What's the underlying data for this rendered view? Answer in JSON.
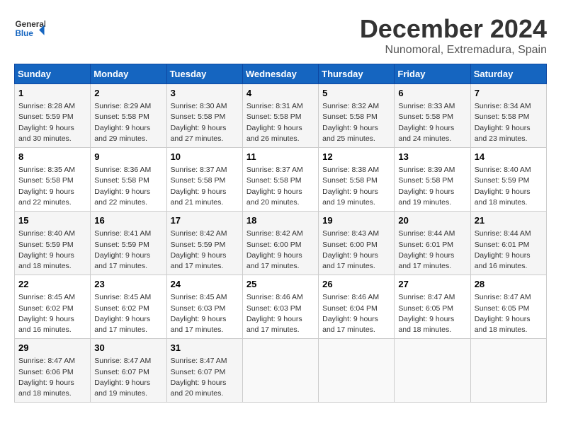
{
  "header": {
    "logo_general": "General",
    "logo_blue": "Blue",
    "month": "December 2024",
    "location": "Nunomoral, Extremadura, Spain"
  },
  "weekdays": [
    "Sunday",
    "Monday",
    "Tuesday",
    "Wednesday",
    "Thursday",
    "Friday",
    "Saturday"
  ],
  "weeks": [
    [
      {
        "day": "1",
        "sunrise": "Sunrise: 8:28 AM",
        "sunset": "Sunset: 5:59 PM",
        "daylight": "Daylight: 9 hours and 30 minutes."
      },
      {
        "day": "2",
        "sunrise": "Sunrise: 8:29 AM",
        "sunset": "Sunset: 5:58 PM",
        "daylight": "Daylight: 9 hours and 29 minutes."
      },
      {
        "day": "3",
        "sunrise": "Sunrise: 8:30 AM",
        "sunset": "Sunset: 5:58 PM",
        "daylight": "Daylight: 9 hours and 27 minutes."
      },
      {
        "day": "4",
        "sunrise": "Sunrise: 8:31 AM",
        "sunset": "Sunset: 5:58 PM",
        "daylight": "Daylight: 9 hours and 26 minutes."
      },
      {
        "day": "5",
        "sunrise": "Sunrise: 8:32 AM",
        "sunset": "Sunset: 5:58 PM",
        "daylight": "Daylight: 9 hours and 25 minutes."
      },
      {
        "day": "6",
        "sunrise": "Sunrise: 8:33 AM",
        "sunset": "Sunset: 5:58 PM",
        "daylight": "Daylight: 9 hours and 24 minutes."
      },
      {
        "day": "7",
        "sunrise": "Sunrise: 8:34 AM",
        "sunset": "Sunset: 5:58 PM",
        "daylight": "Daylight: 9 hours and 23 minutes."
      }
    ],
    [
      {
        "day": "8",
        "sunrise": "Sunrise: 8:35 AM",
        "sunset": "Sunset: 5:58 PM",
        "daylight": "Daylight: 9 hours and 22 minutes."
      },
      {
        "day": "9",
        "sunrise": "Sunrise: 8:36 AM",
        "sunset": "Sunset: 5:58 PM",
        "daylight": "Daylight: 9 hours and 22 minutes."
      },
      {
        "day": "10",
        "sunrise": "Sunrise: 8:37 AM",
        "sunset": "Sunset: 5:58 PM",
        "daylight": "Daylight: 9 hours and 21 minutes."
      },
      {
        "day": "11",
        "sunrise": "Sunrise: 8:37 AM",
        "sunset": "Sunset: 5:58 PM",
        "daylight": "Daylight: 9 hours and 20 minutes."
      },
      {
        "day": "12",
        "sunrise": "Sunrise: 8:38 AM",
        "sunset": "Sunset: 5:58 PM",
        "daylight": "Daylight: 9 hours and 19 minutes."
      },
      {
        "day": "13",
        "sunrise": "Sunrise: 8:39 AM",
        "sunset": "Sunset: 5:58 PM",
        "daylight": "Daylight: 9 hours and 19 minutes."
      },
      {
        "day": "14",
        "sunrise": "Sunrise: 8:40 AM",
        "sunset": "Sunset: 5:59 PM",
        "daylight": "Daylight: 9 hours and 18 minutes."
      }
    ],
    [
      {
        "day": "15",
        "sunrise": "Sunrise: 8:40 AM",
        "sunset": "Sunset: 5:59 PM",
        "daylight": "Daylight: 9 hours and 18 minutes."
      },
      {
        "day": "16",
        "sunrise": "Sunrise: 8:41 AM",
        "sunset": "Sunset: 5:59 PM",
        "daylight": "Daylight: 9 hours and 17 minutes."
      },
      {
        "day": "17",
        "sunrise": "Sunrise: 8:42 AM",
        "sunset": "Sunset: 5:59 PM",
        "daylight": "Daylight: 9 hours and 17 minutes."
      },
      {
        "day": "18",
        "sunrise": "Sunrise: 8:42 AM",
        "sunset": "Sunset: 6:00 PM",
        "daylight": "Daylight: 9 hours and 17 minutes."
      },
      {
        "day": "19",
        "sunrise": "Sunrise: 8:43 AM",
        "sunset": "Sunset: 6:00 PM",
        "daylight": "Daylight: 9 hours and 17 minutes."
      },
      {
        "day": "20",
        "sunrise": "Sunrise: 8:44 AM",
        "sunset": "Sunset: 6:01 PM",
        "daylight": "Daylight: 9 hours and 17 minutes."
      },
      {
        "day": "21",
        "sunrise": "Sunrise: 8:44 AM",
        "sunset": "Sunset: 6:01 PM",
        "daylight": "Daylight: 9 hours and 16 minutes."
      }
    ],
    [
      {
        "day": "22",
        "sunrise": "Sunrise: 8:45 AM",
        "sunset": "Sunset: 6:02 PM",
        "daylight": "Daylight: 9 hours and 16 minutes."
      },
      {
        "day": "23",
        "sunrise": "Sunrise: 8:45 AM",
        "sunset": "Sunset: 6:02 PM",
        "daylight": "Daylight: 9 hours and 17 minutes."
      },
      {
        "day": "24",
        "sunrise": "Sunrise: 8:45 AM",
        "sunset": "Sunset: 6:03 PM",
        "daylight": "Daylight: 9 hours and 17 minutes."
      },
      {
        "day": "25",
        "sunrise": "Sunrise: 8:46 AM",
        "sunset": "Sunset: 6:03 PM",
        "daylight": "Daylight: 9 hours and 17 minutes."
      },
      {
        "day": "26",
        "sunrise": "Sunrise: 8:46 AM",
        "sunset": "Sunset: 6:04 PM",
        "daylight": "Daylight: 9 hours and 17 minutes."
      },
      {
        "day": "27",
        "sunrise": "Sunrise: 8:47 AM",
        "sunset": "Sunset: 6:05 PM",
        "daylight": "Daylight: 9 hours and 18 minutes."
      },
      {
        "day": "28",
        "sunrise": "Sunrise: 8:47 AM",
        "sunset": "Sunset: 6:05 PM",
        "daylight": "Daylight: 9 hours and 18 minutes."
      }
    ],
    [
      {
        "day": "29",
        "sunrise": "Sunrise: 8:47 AM",
        "sunset": "Sunset: 6:06 PM",
        "daylight": "Daylight: 9 hours and 18 minutes."
      },
      {
        "day": "30",
        "sunrise": "Sunrise: 8:47 AM",
        "sunset": "Sunset: 6:07 PM",
        "daylight": "Daylight: 9 hours and 19 minutes."
      },
      {
        "day": "31",
        "sunrise": "Sunrise: 8:47 AM",
        "sunset": "Sunset: 6:07 PM",
        "daylight": "Daylight: 9 hours and 20 minutes."
      },
      null,
      null,
      null,
      null
    ]
  ]
}
